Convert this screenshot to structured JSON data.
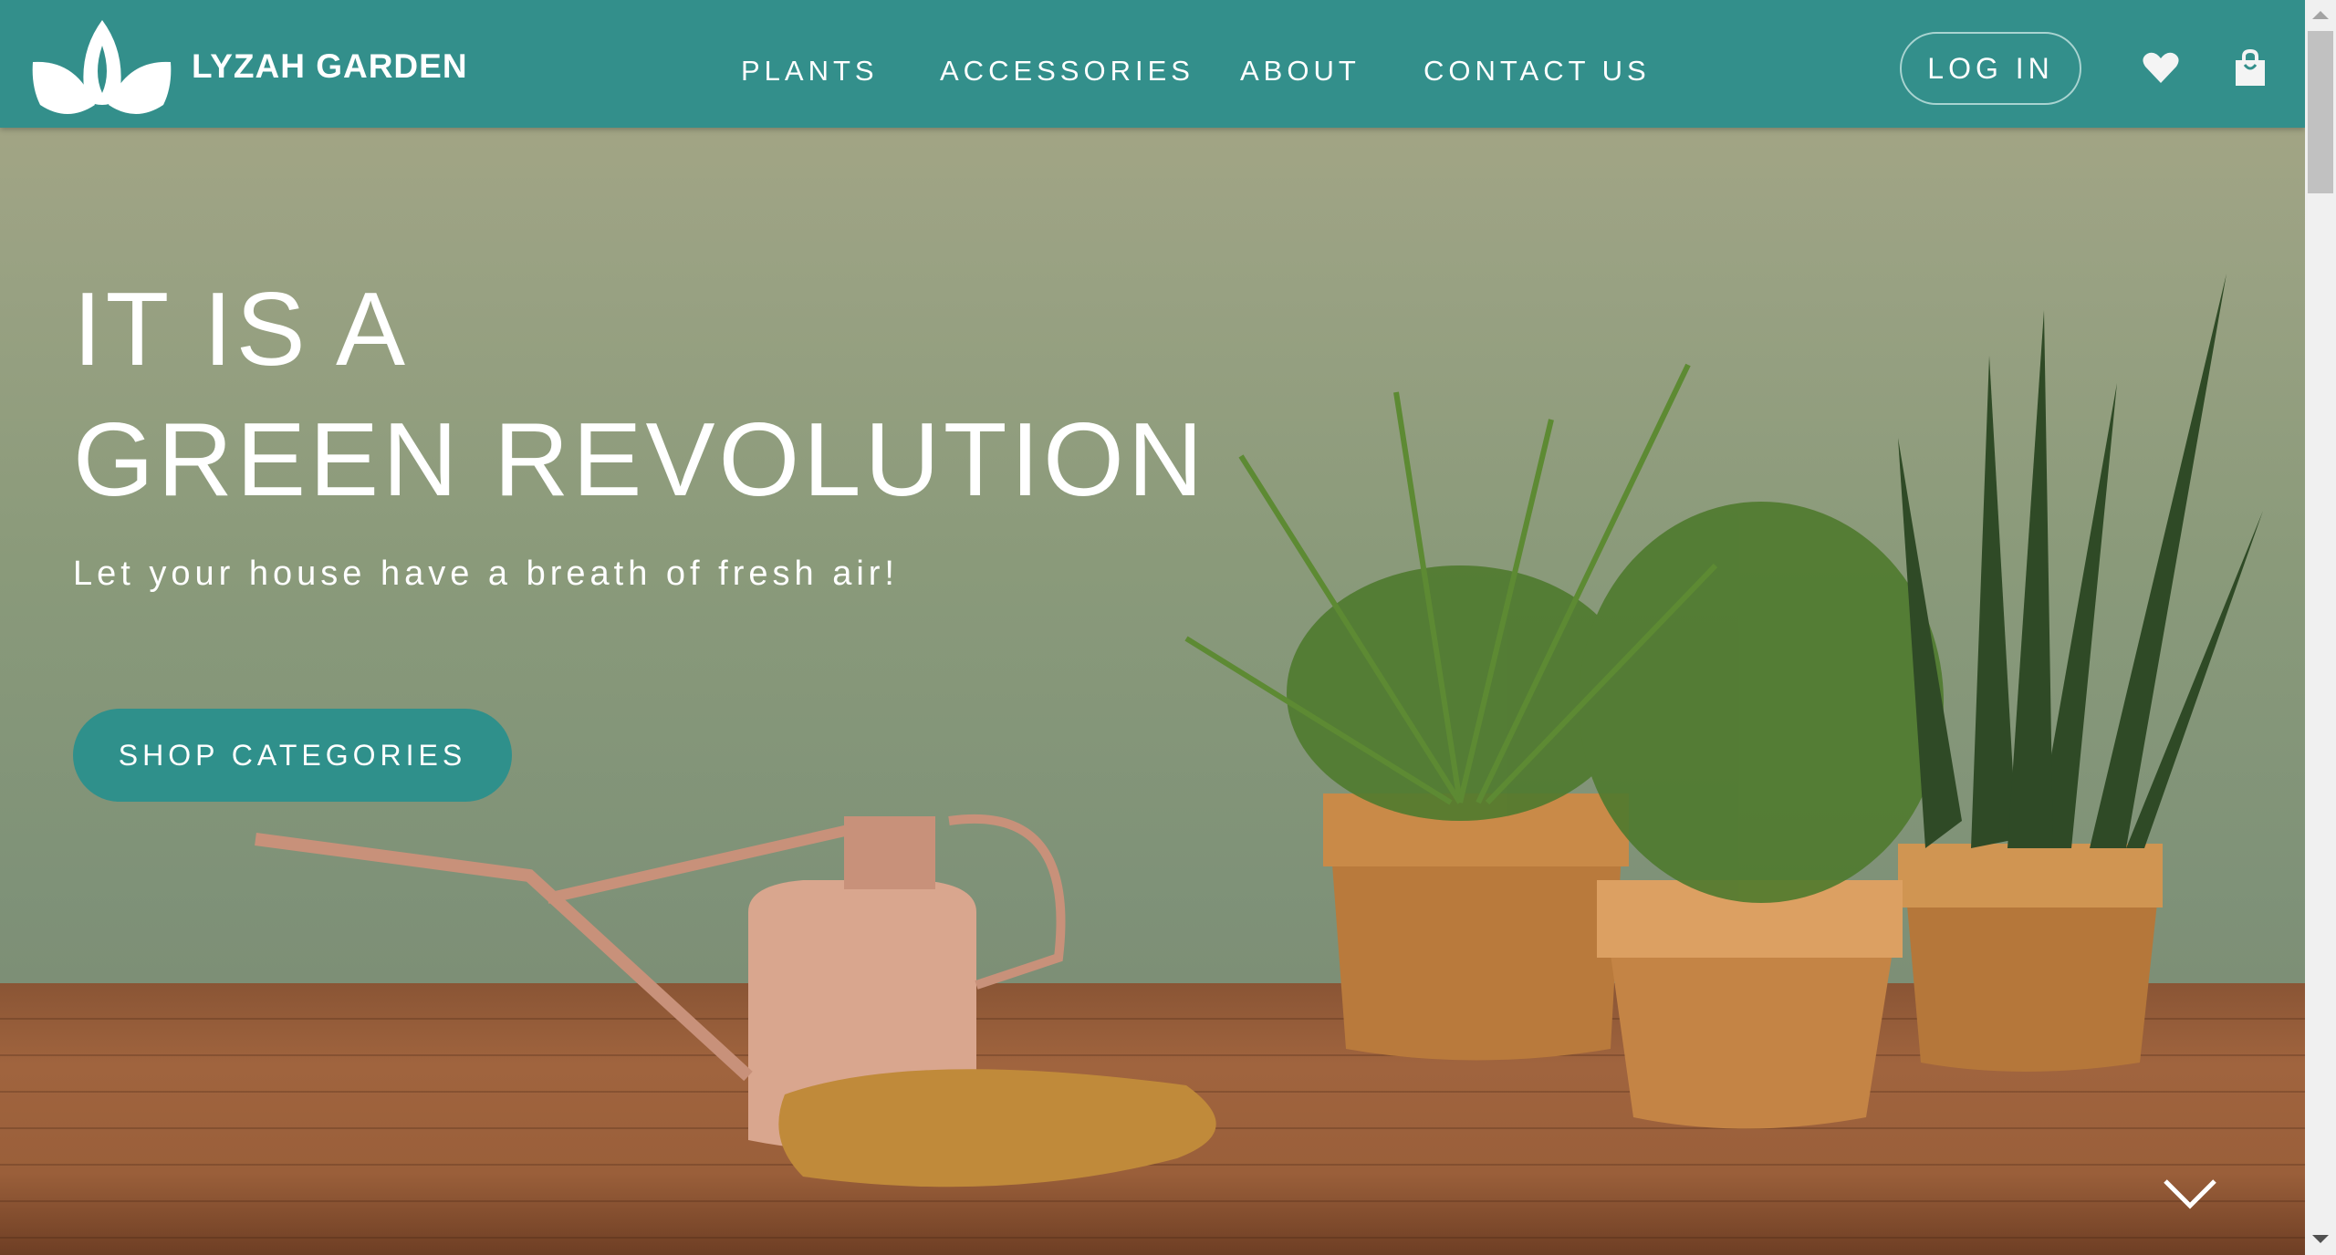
{
  "header": {
    "brand": "LYZAH GARDEN",
    "nav": [
      "PLANTS",
      "ACCESSORIES",
      "ABOUT",
      "CONTACT US"
    ],
    "login": "LOG IN"
  },
  "hero": {
    "title_line1": "IT IS A",
    "title_line2": "GREEN REVOLUTION",
    "subtitle": "Let your house have a breath of fresh air!",
    "cta": "SHOP CATEGORIES"
  },
  "colors": {
    "brand": "#338f8b",
    "button": "#2f908b"
  }
}
